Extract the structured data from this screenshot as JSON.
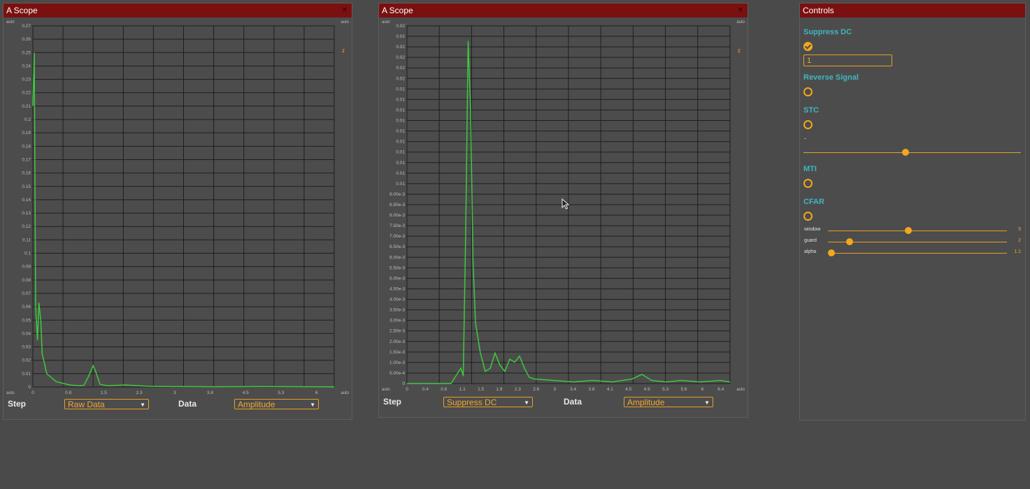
{
  "scope1": {
    "title": "A Scope",
    "auto_tl": "auto",
    "auto_tr": "auto",
    "auto_bl": "auto",
    "auto_br": "auto",
    "z_label": "z",
    "yticks": [
      "0.27",
      "0.26",
      "0.25",
      "0.24",
      "0.23",
      "0.22",
      "0.21",
      "0.2",
      "0.19",
      "0.18",
      "0.17",
      "0.16",
      "0.15",
      "0.14",
      "0.13",
      "0.12",
      "0.11",
      "0.1",
      "0.09",
      "0.08",
      "0.07",
      "0.06",
      "0.05",
      "0.04",
      "0.03",
      "0.02",
      "0.01",
      "0"
    ],
    "xticks": [
      "0",
      "0.8",
      "1.5",
      "2.3",
      "3",
      "3.8",
      "4.5",
      "5.3",
      "6"
    ],
    "step_label": "Step",
    "step_value": "Raw Data",
    "data_label": "Data",
    "data_value": "Amplitude"
  },
  "scope2": {
    "title": "A Scope",
    "auto_tl": "auto",
    "auto_tr": "auto",
    "auto_bl": "auto",
    "auto_br": "auto",
    "z_label": "z",
    "yticks": [
      "0.02",
      "0.02",
      "0.02",
      "0.02",
      "0.02",
      "0.02",
      "0.01",
      "0.01",
      "0.01",
      "0.01",
      "0.01",
      "0.01",
      "0.01",
      "0.01",
      "0.01",
      "0.01",
      "9.00e-3",
      "8.50e-3",
      "8.00e-3",
      "7.50e-3",
      "7.00e-3",
      "6.50e-3",
      "6.00e-3",
      "5.50e-3",
      "5.00e-3",
      "4.50e-3",
      "4.00e-3",
      "3.50e-3",
      "3.00e-3",
      "2.50e-3",
      "2.00e-3",
      "1.50e-3",
      "1.00e-3",
      "5.00e-4",
      "0"
    ],
    "xticks": [
      "0",
      "0.4",
      "0.8",
      "1.1",
      "1.5",
      "1.9",
      "2.3",
      "2.6",
      "3",
      "3.4",
      "3.8",
      "4.1",
      "4.5",
      "4.9",
      "5.3",
      "5.6",
      "6",
      "6.4"
    ],
    "step_label": "Step",
    "step_value": "Suppress DC",
    "data_label": "Data",
    "data_value": "Amplitude"
  },
  "controls": {
    "title": "Controls",
    "suppress_dc": {
      "label": "Suppress DC",
      "checked": true,
      "value": "1"
    },
    "reverse_signal": {
      "label": "Reverse Signal",
      "checked": false
    },
    "stc": {
      "label": "STC",
      "checked": false,
      "slider_label": "-",
      "slider_position": 0.47
    },
    "mti": {
      "label": "MTI",
      "checked": false
    },
    "cfar": {
      "label": "CFAR",
      "checked": false,
      "sliders": [
        {
          "label": "window",
          "value": "5",
          "position": 0.45
        },
        {
          "label": "guard",
          "value": "2",
          "position": 0.12
        },
        {
          "label": "alpha",
          "value": "1.1",
          "position": 0.02
        }
      ]
    }
  },
  "chart_data": [
    {
      "type": "line",
      "series": [
        {
          "x": [
            0,
            0.03,
            0.06,
            0.1,
            0.13,
            0.17,
            0.2,
            0.3,
            0.5,
            0.8,
            1.0,
            1.1,
            1.2,
            1.3,
            1.35,
            1.45,
            1.6,
            2.0,
            2.5,
            3.0,
            4.0,
            5.0,
            6.0,
            6.5
          ],
          "y": [
            0.21,
            0.25,
            0.06,
            0.035,
            0.063,
            0.05,
            0.025,
            0.01,
            0.004,
            0.0015,
            0.001,
            0.0012,
            0.008,
            0.016,
            0.012,
            0.002,
            0.001,
            0.0015,
            0.0005,
            0.0003,
            0.0002,
            0.0003,
            0.0002,
            0.0001
          ]
        }
      ],
      "ylim": [
        0,
        0.27
      ],
      "xlim": [
        0,
        6.5
      ],
      "color": "#3ec93e",
      "grid": true
    },
    {
      "type": "line",
      "series": [
        {
          "x": [
            0,
            0.9,
            1.0,
            1.1,
            1.15,
            1.2,
            1.25,
            1.3,
            1.35,
            1.4,
            1.5,
            1.6,
            1.7,
            1.8,
            1.9,
            2.0,
            2.1,
            2.2,
            2.3,
            2.4,
            2.5,
            2.6,
            3.0,
            3.4,
            3.8,
            4.2,
            4.6,
            4.8,
            5.0,
            5.3,
            5.6,
            6.0,
            6.4,
            6.6
          ],
          "y": [
            0,
            0,
            0.0005,
            0.001,
            0.0005,
            0.01,
            0.0225,
            0.018,
            0.008,
            0.004,
            0.002,
            0.0008,
            0.001,
            0.002,
            0.0012,
            0.0008,
            0.0016,
            0.0014,
            0.0018,
            0.001,
            0.0004,
            0.0003,
            0.0002,
            0.0001,
            0.0002,
            0.0001,
            0.0003,
            0.0006,
            0.0002,
            0.0001,
            0.0002,
            0.0001,
            0.0002,
            0.0001
          ]
        }
      ],
      "ylim": [
        0,
        0.0235
      ],
      "xlim": [
        0,
        6.6
      ],
      "color": "#3ec93e",
      "grid": true
    }
  ]
}
